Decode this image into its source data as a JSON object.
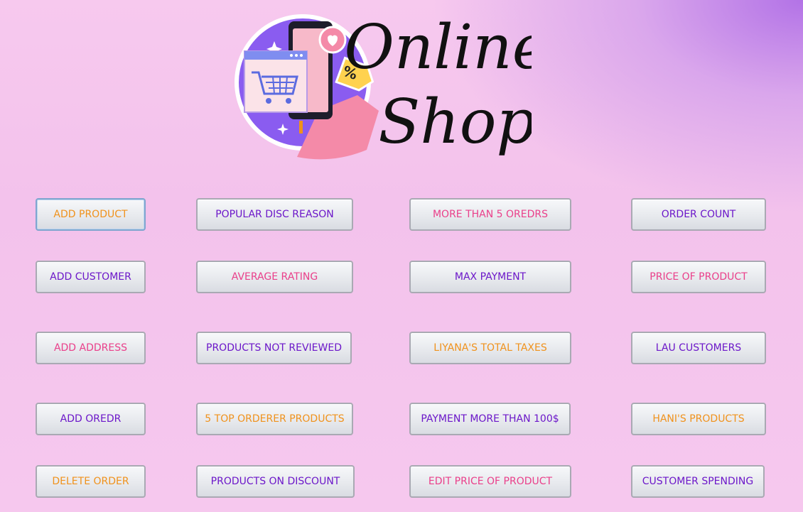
{
  "logo": {
    "title_line1": "Online",
    "title_line2": "Shop",
    "tag_text": "%"
  },
  "colors": {
    "orange": "#f0921c",
    "purple": "#6c17c9",
    "pink": "#ea3f8a"
  },
  "buttons": {
    "add_product": "ADD PRODUCT",
    "popular_disc_reason": "POPULAR DISC REASON",
    "more_than_5_orders": "MORE THAN 5 OREDRS",
    "order_count": "ORDER COUNT",
    "add_customer": "ADD CUSTOMER",
    "average_rating": "AVERAGE RATING",
    "max_payment": "MAX  PAYMENT",
    "price_of_product": "PRICE OF PRODUCT",
    "add_address": "ADD ADDRESS",
    "products_not_reviewed": "PRODUCTS NOT REVIEWED",
    "liyana_total_taxes": "LIYANA'S TOTAL TAXES",
    "lau_customers": "LAU CUSTOMERS",
    "add_order": "ADD OREDR",
    "top_5_orderer_products": "5 TOP ORDERER PRODUCTS",
    "payment_more_than_100": "PAYMENT MORE THAN 100$",
    "hani_products": "HANI'S PRODUCTS",
    "delete_order": "DELETE ORDER",
    "products_on_discount": "PRODUCTS ON DISCOUNT",
    "edit_price_of_product": "EDIT PRICE OF PRODUCT",
    "customer_spending": "CUSTOMER SPENDING"
  }
}
